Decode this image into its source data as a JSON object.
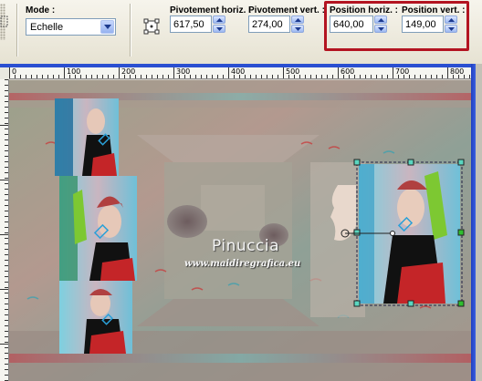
{
  "toolbar": {
    "mode": {
      "label": "Mode :",
      "value": "Echelle"
    },
    "pivot_horiz": {
      "label": "Pivotement horiz. :",
      "value": "617,50"
    },
    "pivot_vert": {
      "label": "Pivotement vert. :",
      "value": "274,00"
    },
    "position_horiz": {
      "label": "Position horiz. :",
      "value": "640,00"
    },
    "position_vert": {
      "label": "Position vert. :",
      "value": "149,00"
    },
    "highlight_color": "#b31421"
  },
  "ruler": {
    "ticks": [
      "0",
      "100",
      "200",
      "300",
      "400",
      "500",
      "600",
      "700",
      "800"
    ]
  },
  "watermark": {
    "title": "Pinuccia",
    "url": "www.maidiregrafica.eu"
  },
  "colors": {
    "window_border": "#2a4fd1",
    "field_border": "#7f9db9"
  }
}
